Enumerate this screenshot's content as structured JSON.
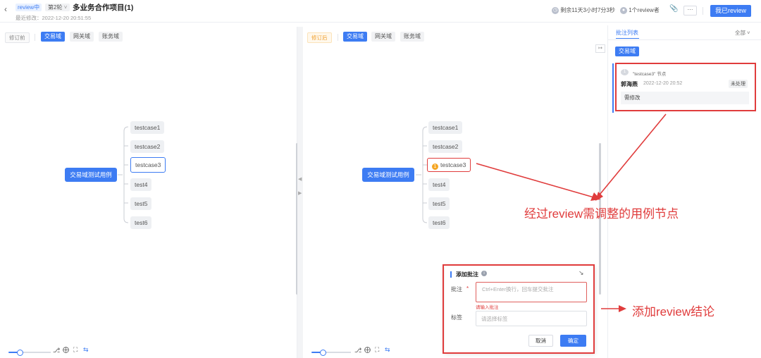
{
  "header": {
    "back_icon": "chevron-left-icon",
    "status_badge": "review中",
    "round_select": "第2轮",
    "project_title": "多业务合作项目(1)",
    "last_modified": "最近修改：2022-12-20 20:51:55",
    "remaining_time": "剩余11天3小时7分3秒",
    "reviewers": "1个review者",
    "more_label": "···",
    "main_button": "我已review"
  },
  "left_panel": {
    "version_tag": "修订前",
    "tabs": [
      "交易域",
      "网关域",
      "账务域"
    ],
    "root": "交易域测试用例",
    "children": [
      "testcase1",
      "testcase2",
      "testcase3",
      "test4",
      "test5",
      "test6"
    ]
  },
  "mid_panel": {
    "version_tag": "修订后",
    "tabs": [
      "交易域",
      "网关域",
      "账务域"
    ],
    "root": "交易域测试用例",
    "children": [
      "testcase1",
      "testcase2",
      "testcase3",
      "test4",
      "test5",
      "test6"
    ],
    "flag_count": "1"
  },
  "dialog": {
    "title": "添加批注",
    "comment_label": "批注",
    "required_mark": "*",
    "comment_placeholder": "Ctrl+Enter换行，回车提交批注",
    "error_text": "请输入批注",
    "tag_label": "标签",
    "tag_placeholder": "请选择标签",
    "cancel": "取消",
    "confirm": "确定"
  },
  "right_panel": {
    "title": "批注列表",
    "filter": "全部",
    "domain_tag": "交易域",
    "comment": {
      "index": "1",
      "node_ref": "\"testcase3\" 节点",
      "author": "郭海燕",
      "time": "2022-12-20 20:52",
      "status": "未处理",
      "content": "需修改"
    }
  },
  "annotations": {
    "node_note": "经过review需调整的用例节点",
    "dialog_note": "添加review结论"
  },
  "colors": {
    "accent": "#3d7cf3",
    "annotation_red": "#e03c3c",
    "warning": "#f5a623"
  }
}
